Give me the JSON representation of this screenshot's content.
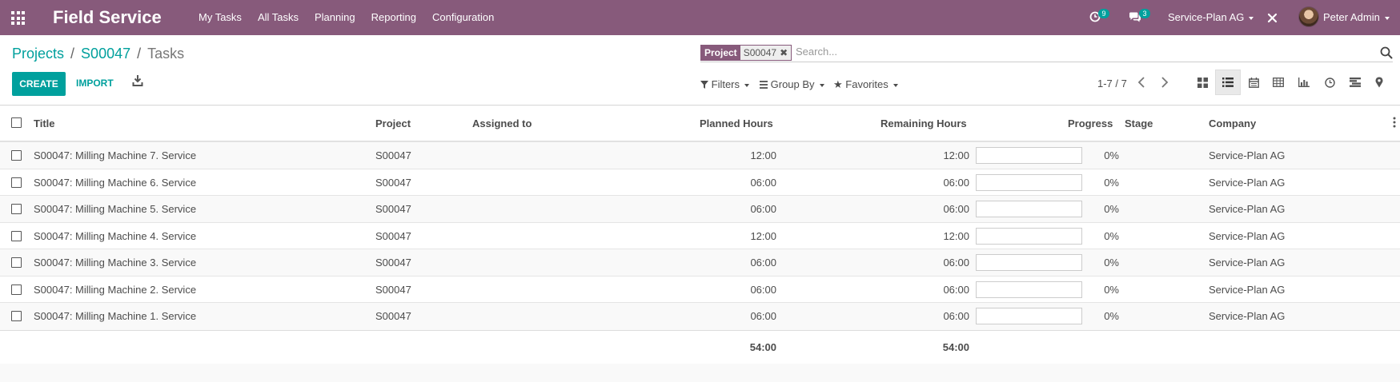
{
  "navbar": {
    "brand": "Field Service",
    "menu": [
      "My Tasks",
      "All Tasks",
      "Planning",
      "Reporting",
      "Configuration"
    ],
    "activity_count": "9",
    "messages_count": "3",
    "company": "Service-Plan AG",
    "user": "Peter Admin"
  },
  "breadcrumb": {
    "projects": "Projects",
    "record": "S00047",
    "current": "Tasks"
  },
  "actions": {
    "create": "CREATE",
    "import": "IMPORT"
  },
  "search": {
    "facet_label": "Project",
    "facet_value": "S00047",
    "placeholder": "Search..."
  },
  "filters": {
    "filters": "Filters",
    "group_by": "Group By",
    "favorites": "Favorites"
  },
  "pager": {
    "value": "1-7 / 7"
  },
  "views": [
    "kanban",
    "list",
    "calendar",
    "pivot",
    "graph",
    "activity",
    "gantt",
    "map"
  ],
  "active_view": "list",
  "table": {
    "columns": {
      "title": "Title",
      "project": "Project",
      "assigned": "Assigned to",
      "planned": "Planned Hours",
      "remaining": "Remaining Hours",
      "progress": "Progress",
      "stage": "Stage",
      "company": "Company"
    },
    "rows": [
      {
        "title": "S00047: Milling Machine 7. Service",
        "project": "S00047",
        "assigned": "",
        "planned": "12:00",
        "remaining": "12:00",
        "progress_value": 0,
        "progress": "0%",
        "stage": "",
        "company": "Service-Plan AG"
      },
      {
        "title": "S00047: Milling Machine 6. Service",
        "project": "S00047",
        "assigned": "",
        "planned": "06:00",
        "remaining": "06:00",
        "progress_value": 0,
        "progress": "0%",
        "stage": "",
        "company": "Service-Plan AG"
      },
      {
        "title": "S00047: Milling Machine 5. Service",
        "project": "S00047",
        "assigned": "",
        "planned": "06:00",
        "remaining": "06:00",
        "progress_value": 0,
        "progress": "0%",
        "stage": "",
        "company": "Service-Plan AG"
      },
      {
        "title": "S00047: Milling Machine 4. Service",
        "project": "S00047",
        "assigned": "",
        "planned": "12:00",
        "remaining": "12:00",
        "progress_value": 0,
        "progress": "0%",
        "stage": "",
        "company": "Service-Plan AG"
      },
      {
        "title": "S00047: Milling Machine 3. Service",
        "project": "S00047",
        "assigned": "",
        "planned": "06:00",
        "remaining": "06:00",
        "progress_value": 0,
        "progress": "0%",
        "stage": "",
        "company": "Service-Plan AG"
      },
      {
        "title": "S00047: Milling Machine 2. Service",
        "project": "S00047",
        "assigned": "",
        "planned": "06:00",
        "remaining": "06:00",
        "progress_value": 0,
        "progress": "0%",
        "stage": "",
        "company": "Service-Plan AG"
      },
      {
        "title": "S00047: Milling Machine 1. Service",
        "project": "S00047",
        "assigned": "",
        "planned": "06:00",
        "remaining": "06:00",
        "progress_value": 0,
        "progress": "0%",
        "stage": "",
        "company": "Service-Plan AG"
      }
    ],
    "totals": {
      "planned": "54:00",
      "remaining": "54:00"
    }
  },
  "colors": {
    "brand": "#875a7b",
    "accent": "#00a09d"
  }
}
